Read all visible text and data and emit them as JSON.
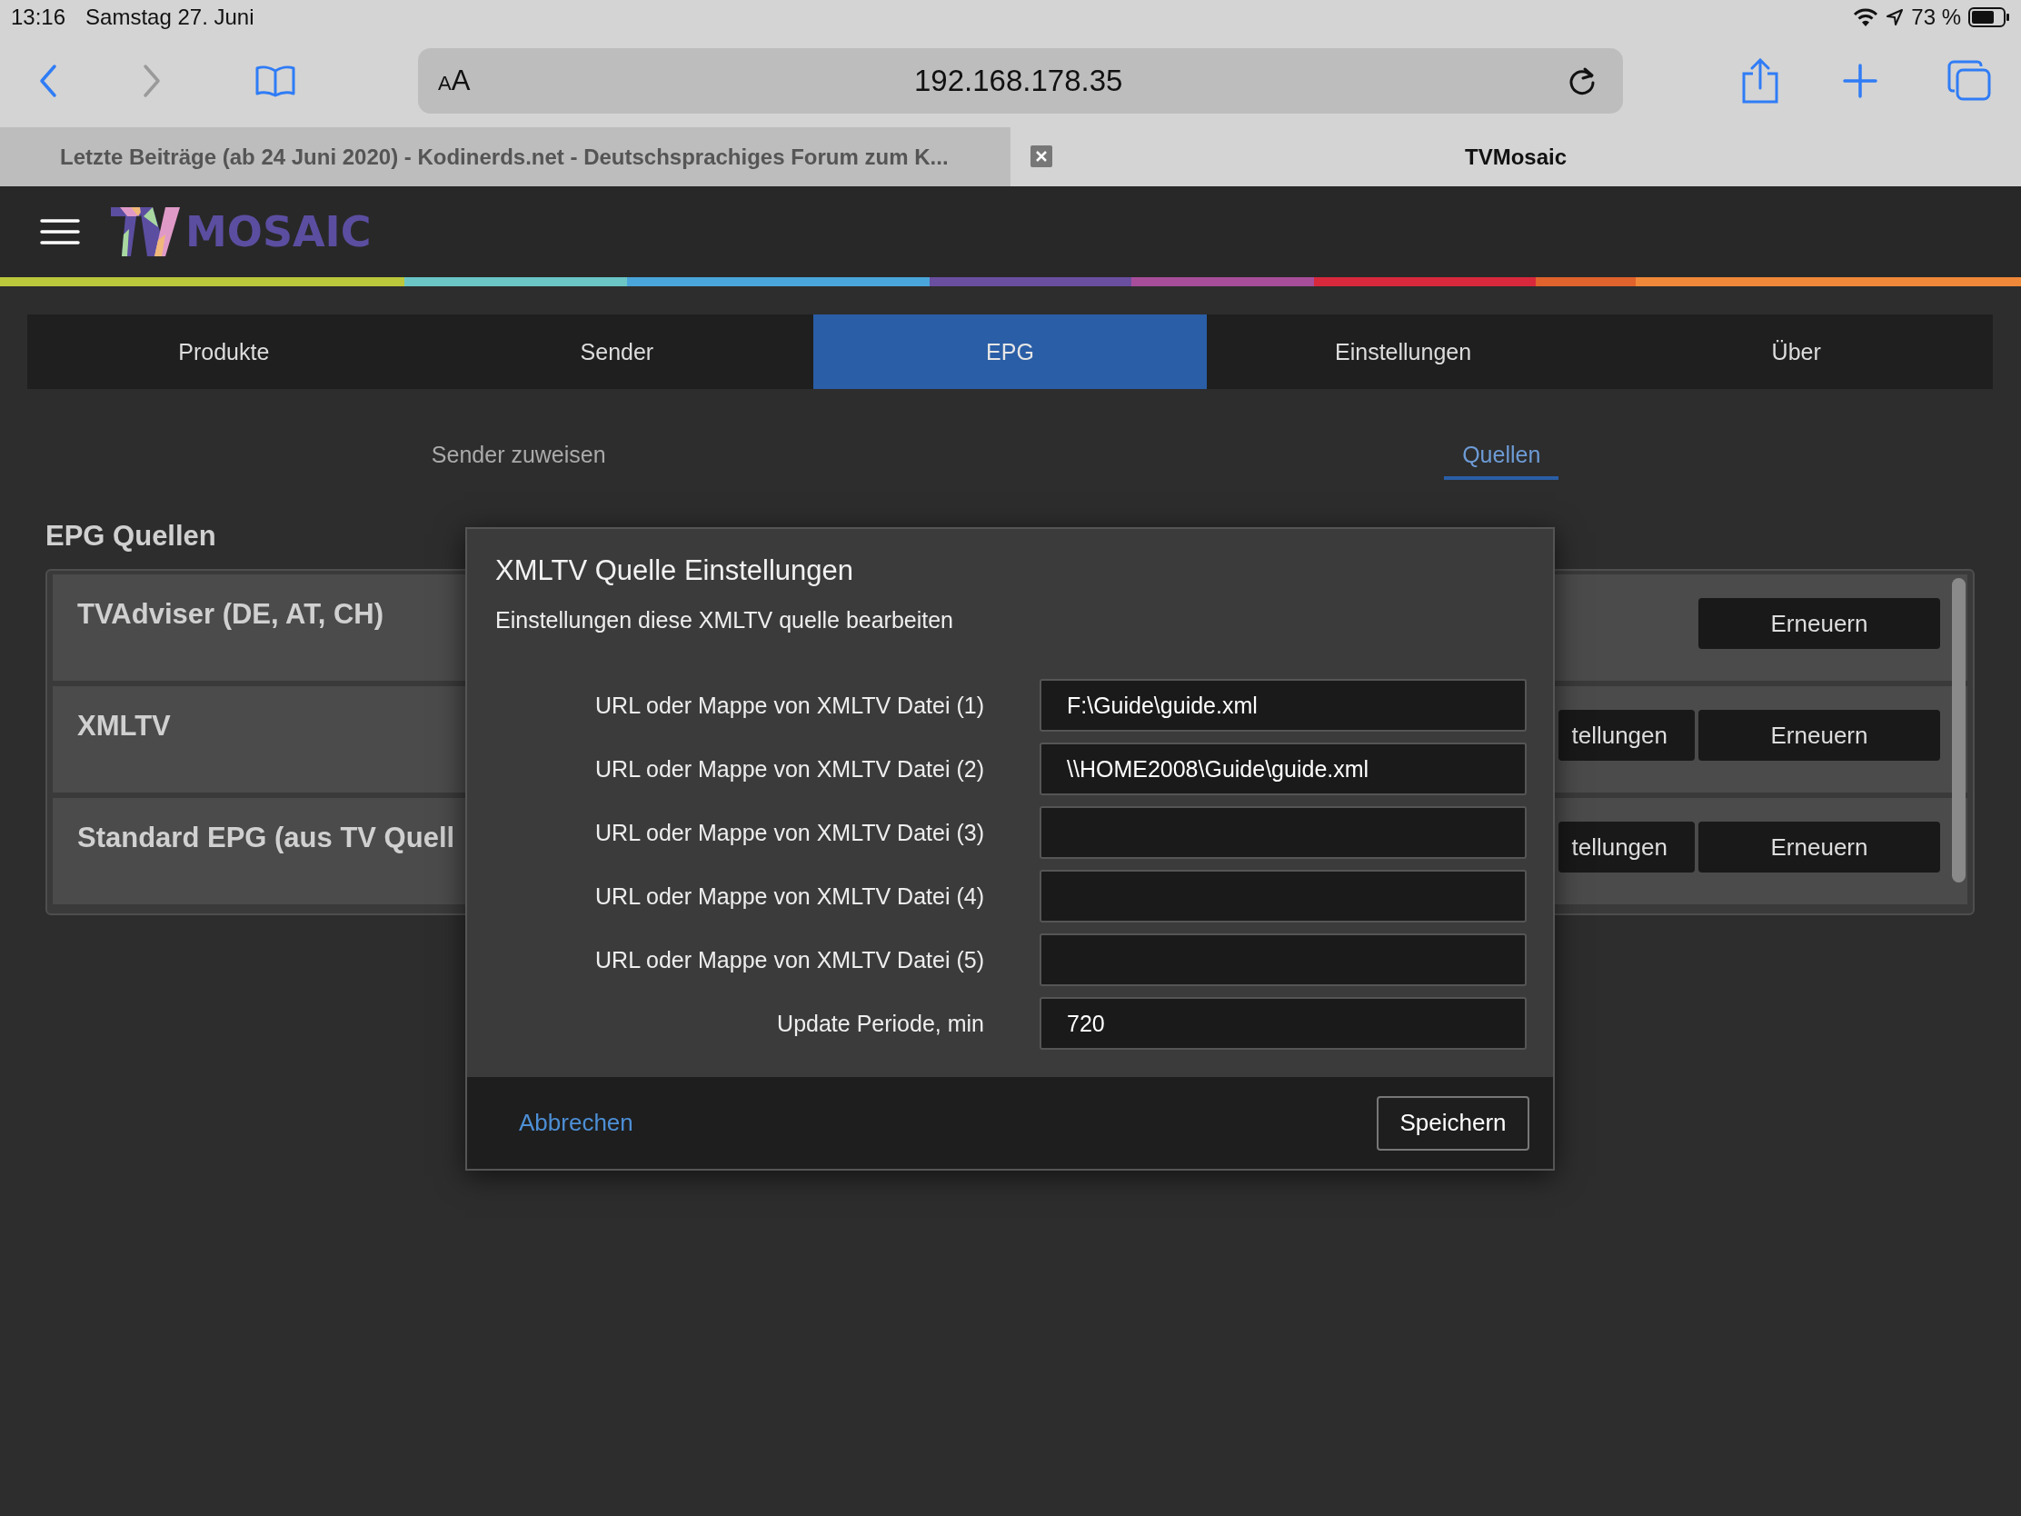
{
  "status_bar": {
    "time": "13:16",
    "date": "Samstag 27. Juni",
    "battery": "73 %"
  },
  "browser": {
    "back_disabled": false,
    "forward_disabled": true,
    "text_size": {
      "small": "A",
      "large": "A"
    },
    "url": "192.168.178.35",
    "tabs": [
      {
        "title": "Letzte Beiträge (ab 24 Juni 2020) - Kodinerds.net - Deutschsprachiges Forum zum K...",
        "selected": false
      },
      {
        "title": "TVMosaic",
        "selected": true
      }
    ]
  },
  "app": {
    "logo_text": "MOSAIC",
    "tabs": [
      {
        "label": "Produkte",
        "selected": false
      },
      {
        "label": "Sender",
        "selected": false
      },
      {
        "label": "EPG",
        "selected": true
      },
      {
        "label": "Einstellungen",
        "selected": false
      },
      {
        "label": "Über",
        "selected": false
      }
    ],
    "subtabs": [
      {
        "label": "Sender zuweisen",
        "selected": false
      },
      {
        "label": "Quellen",
        "selected": true
      }
    ],
    "section_title": "EPG Quellen",
    "sources": [
      {
        "name": "TVAdviser (DE, AT, CH)",
        "buttons": [
          {
            "kind": "refresh",
            "label": "Erneuern"
          }
        ]
      },
      {
        "name": "XMLTV",
        "buttons": [
          {
            "kind": "settings",
            "label": "tellungen"
          },
          {
            "kind": "refresh",
            "label": "Erneuern"
          }
        ]
      },
      {
        "name": "Standard EPG (aus TV Quell",
        "buttons": [
          {
            "kind": "settings",
            "label": "tellungen"
          },
          {
            "kind": "refresh",
            "label": "Erneuern"
          }
        ]
      }
    ]
  },
  "dialog": {
    "title": "XMLTV Quelle Einstellungen",
    "subtitle": "Einstellungen diese XMLTV quelle bearbeiten",
    "fields": [
      {
        "label": "URL oder Mappe von XMLTV Datei (1)",
        "value": "F:\\Guide\\guide.xml"
      },
      {
        "label": "URL oder Mappe von XMLTV Datei (2)",
        "value": "\\\\HOME2008\\Guide\\guide.xml"
      },
      {
        "label": "URL oder Mappe von XMLTV Datei (3)"
      },
      {
        "label": "URL oder Mappe von XMLTV Datei (4)"
      },
      {
        "label": "URL oder Mappe von XMLTV Datei (5)"
      },
      {
        "label": "Update Periode, min",
        "value": "720"
      }
    ],
    "cancel": "Abbrechen",
    "save": "Speichern"
  }
}
